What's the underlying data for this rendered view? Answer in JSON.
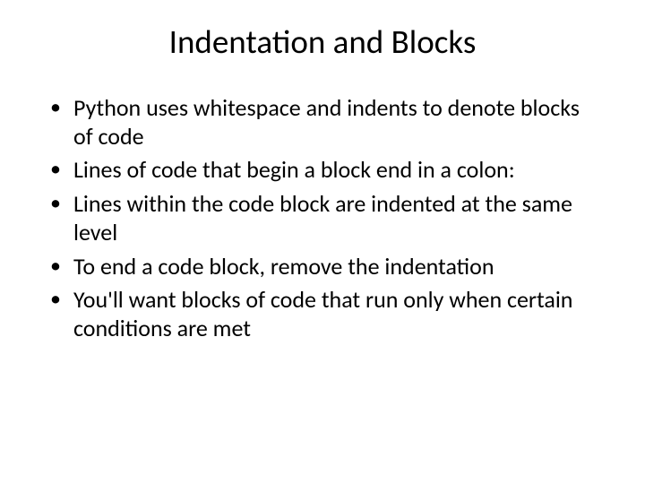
{
  "slide": {
    "title": "Indentation and Blocks",
    "bullets": [
      "Python uses whitespace and indents to denote blocks of code",
      "Lines of code that begin a block end in a colon:",
      "Lines within the code block are indented at the same level",
      "To end a code block, remove the indentation",
      "You'll want blocks of code that run only when certain conditions are met"
    ]
  }
}
